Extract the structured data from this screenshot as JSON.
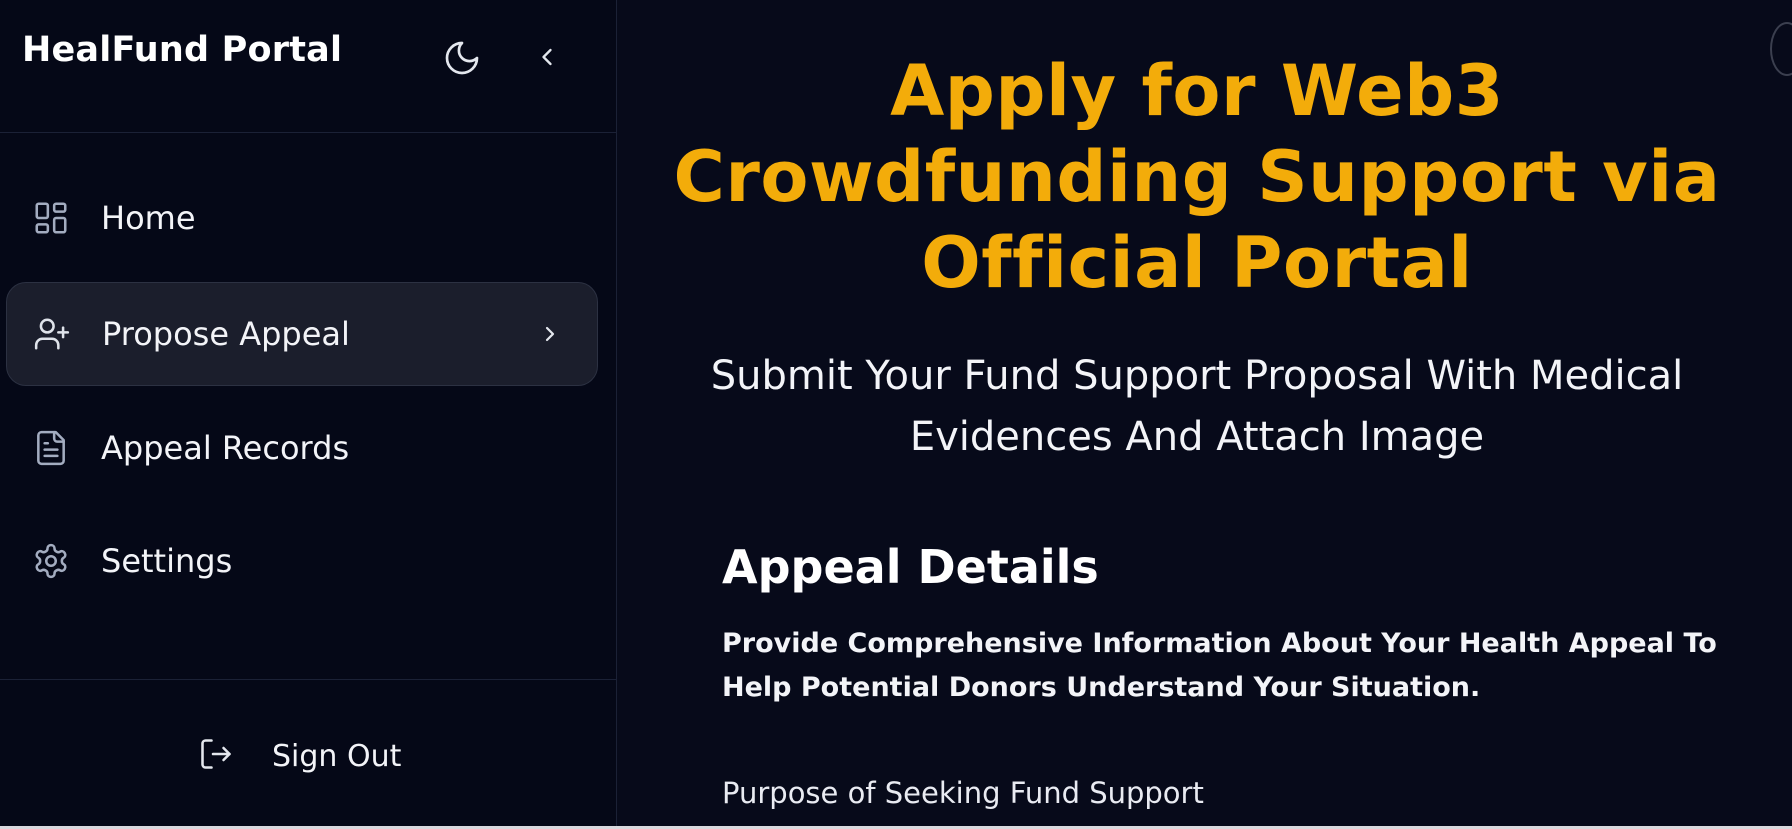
{
  "sidebar": {
    "brand": "HealFund Portal",
    "nav": [
      {
        "label": "Home",
        "icon": "dashboard-icon",
        "active": false
      },
      {
        "label": "Propose Appeal",
        "icon": "user-plus-icon",
        "active": true
      },
      {
        "label": "Appeal Records",
        "icon": "document-icon",
        "active": false
      },
      {
        "label": "Settings",
        "icon": "gear-icon",
        "active": false
      }
    ],
    "sign_out_label": "Sign Out"
  },
  "main": {
    "title": "Apply for Web3 Crowdfunding Support via Official Portal",
    "subtitle": "Submit Your Fund Support Proposal With Medical Evidences And Attach Image",
    "section_title": "Appeal Details",
    "section_description": "Provide Comprehensive Information About Your Health Appeal To Help Potential Donors Understand Your Situation.",
    "field_label": "Purpose of Seeking Fund Support"
  },
  "colors": {
    "background": "#070a1a",
    "sidebar": "#050817",
    "accent": "#f3ac0a",
    "active_item": "#1b1e2c",
    "icon": "#a3acc0"
  }
}
